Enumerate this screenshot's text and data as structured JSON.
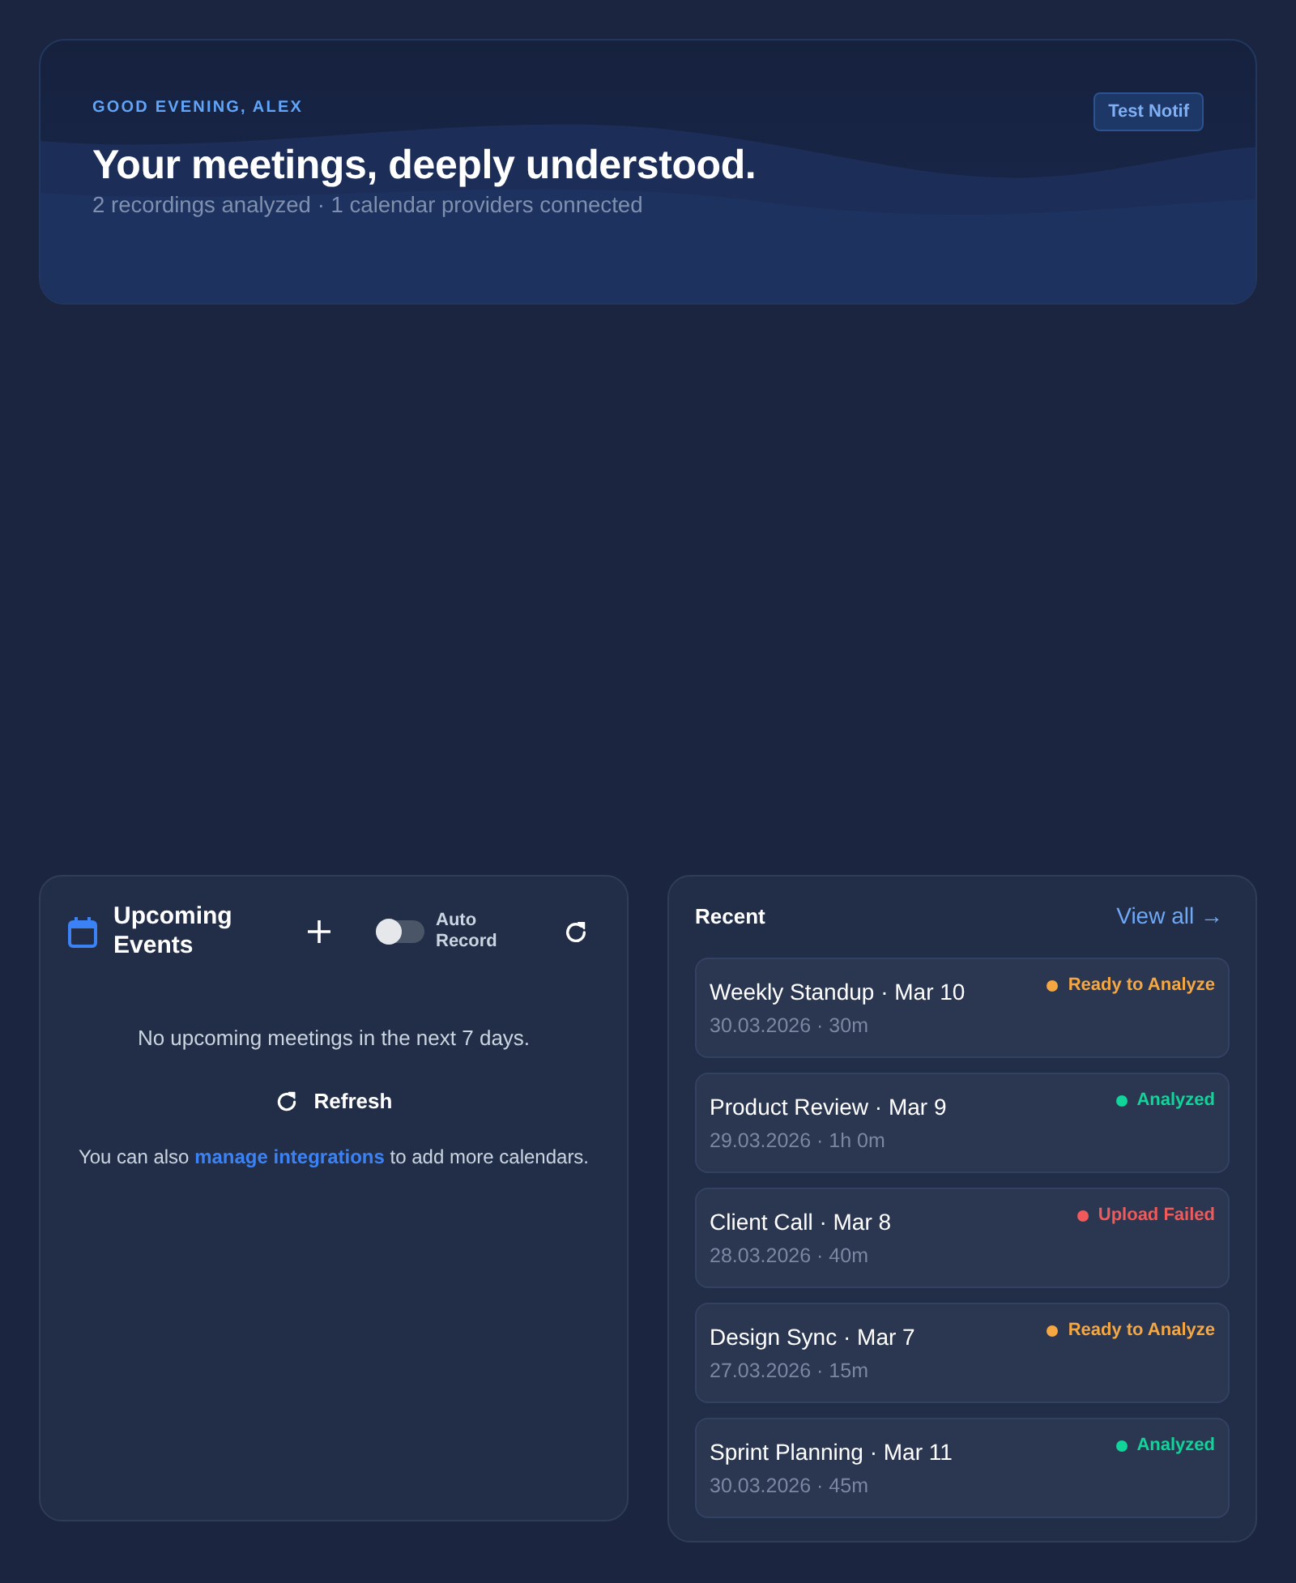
{
  "hero": {
    "greeting": "GOOD EVENING, ALEX",
    "title": "Your meetings, deeply understood.",
    "subtitle": "2 recordings analyzed · 1 calendar providers connected",
    "button": "Test Notif"
  },
  "upcoming": {
    "title": "Upcoming Events",
    "auto_record": {
      "label": "Auto Record",
      "on": false
    },
    "empty_message": "No upcoming meetings in the next 7 days.",
    "refresh_button": "Refresh",
    "hint": {
      "before": "You can also",
      "link": "manage integrations",
      "after": "to add more calendars."
    }
  },
  "recent": {
    "title": "Recent",
    "view_all": "View all →",
    "items": [
      {
        "title": "Weekly Standup · Mar 10",
        "meta": "30.03.2026 · 30m",
        "status": "Ready to Analyze",
        "color": "#f5a742"
      },
      {
        "title": "Product Review · Mar 9",
        "meta": "29.03.2026 · 1h 0m",
        "status": "Analyzed",
        "color": "#10d49a"
      },
      {
        "title": "Client Call · Mar 8",
        "meta": "28.03.2026 · 40m",
        "status": "Upload Failed",
        "color": "#f05a5a"
      },
      {
        "title": "Design Sync · Mar 7",
        "meta": "27.03.2026 · 15m",
        "status": "Ready to Analyze",
        "color": "#f5a742"
      },
      {
        "title": "Sprint Planning · Mar 11",
        "meta": "30.03.2026 · 45m",
        "status": "Analyzed",
        "color": "#10d49a"
      }
    ]
  }
}
